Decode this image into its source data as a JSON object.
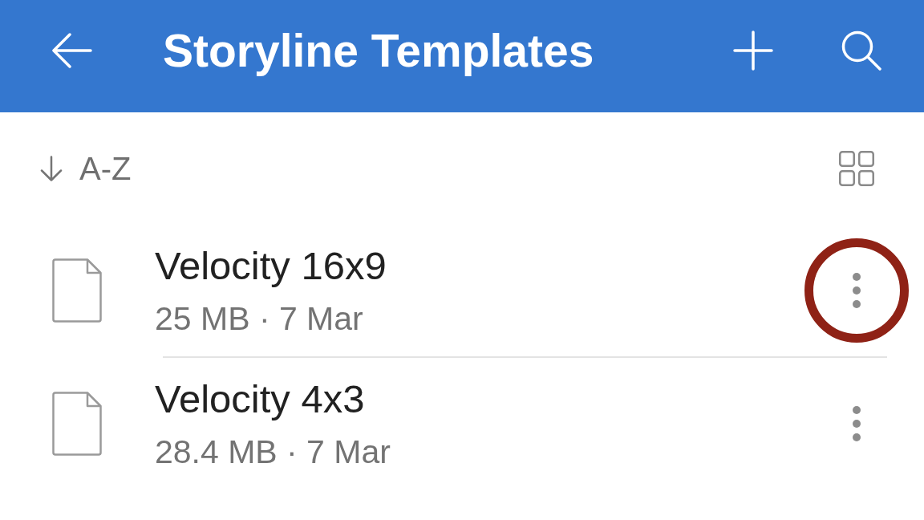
{
  "app_bar": {
    "title": "Storyline Templates"
  },
  "sort": {
    "label": "A-Z"
  },
  "files": [
    {
      "name": "Velocity 16x9",
      "details": "25 MB · 7 Mar",
      "highlighted": true
    },
    {
      "name": "Velocity 4x3",
      "details": "28.4 MB · 7 Mar",
      "highlighted": false
    }
  ]
}
